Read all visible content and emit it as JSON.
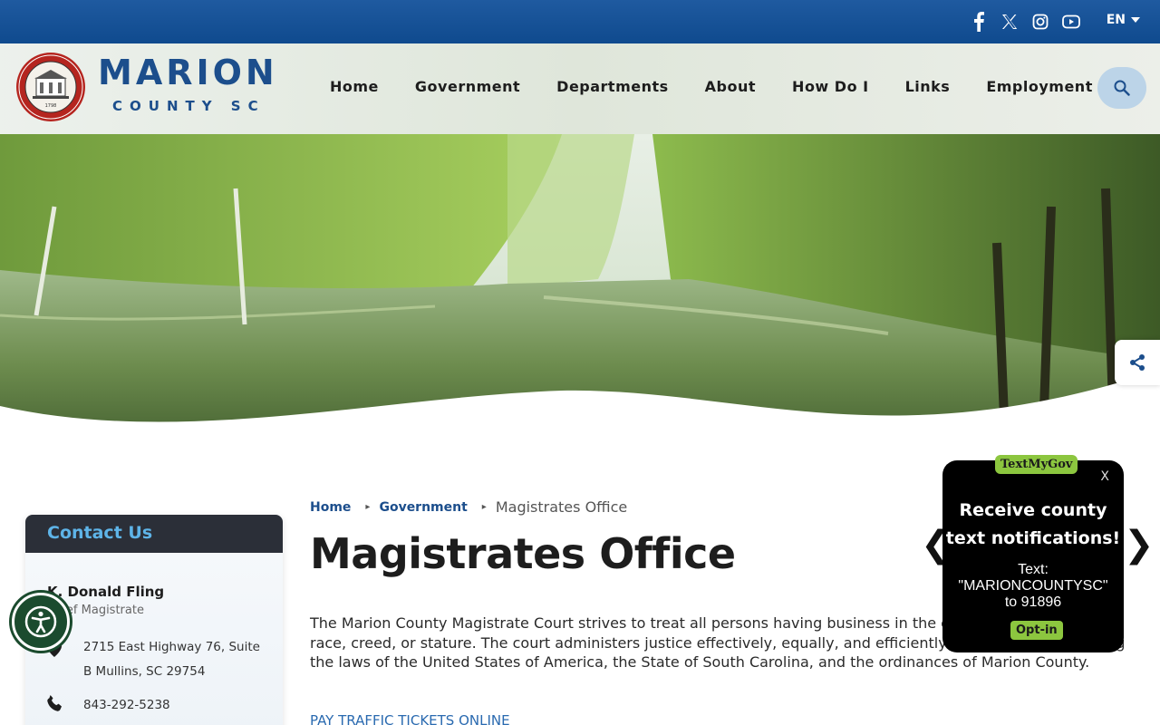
{
  "topbar": {
    "social_icons": [
      "facebook-icon",
      "x-twitter-icon",
      "instagram-icon",
      "youtube-icon"
    ],
    "language": "EN"
  },
  "header": {
    "brand_line1": "MARION",
    "brand_line2": "COUNTY SC",
    "nav": [
      "Home",
      "Government",
      "Departments",
      "About",
      "How Do I",
      "Links",
      "Employment"
    ]
  },
  "contact": {
    "heading": "Contact Us",
    "name": "K. Donald Fling",
    "title": "Chief Magistrate",
    "address_line1": "2715 East Highway 76, Suite",
    "address_line2": "B Mullins, SC  29754",
    "phone": "843-292-5238"
  },
  "breadcrumb": {
    "home": "Home",
    "government": "Government",
    "current": "Magistrates Office"
  },
  "main": {
    "title": "Magistrates Office",
    "description": "The Marion County Magistrate Court strives to treat all persons having business in the court fairly, regardless of race, creed, or stature. The court administers justice effectively, equally, and efficiently following and upholding the laws of the United States of America, the State of South Carolina, and the ordinances of Marion County.",
    "link": "PAY TRAFFIC TICKETS ONLINE"
  },
  "textmygov": {
    "tag": "TextMyGov",
    "close": "X",
    "headline_1": "Receive county",
    "headline_2": "text notifications!",
    "body_1": "Text:",
    "body_2": "\"MARIONCOUNTYSC\"",
    "body_3": "to 91896",
    "optin": "Opt-in",
    "prev": "❮",
    "next": "❯"
  },
  "colors": {
    "topbar": "#1f5aa0",
    "brand": "#1c4e8c",
    "contact_head": "#2b2f38",
    "contact_title": "#5eb4e8",
    "a11y": "#1b4b2e",
    "tmg_green": "#8cc63f"
  }
}
